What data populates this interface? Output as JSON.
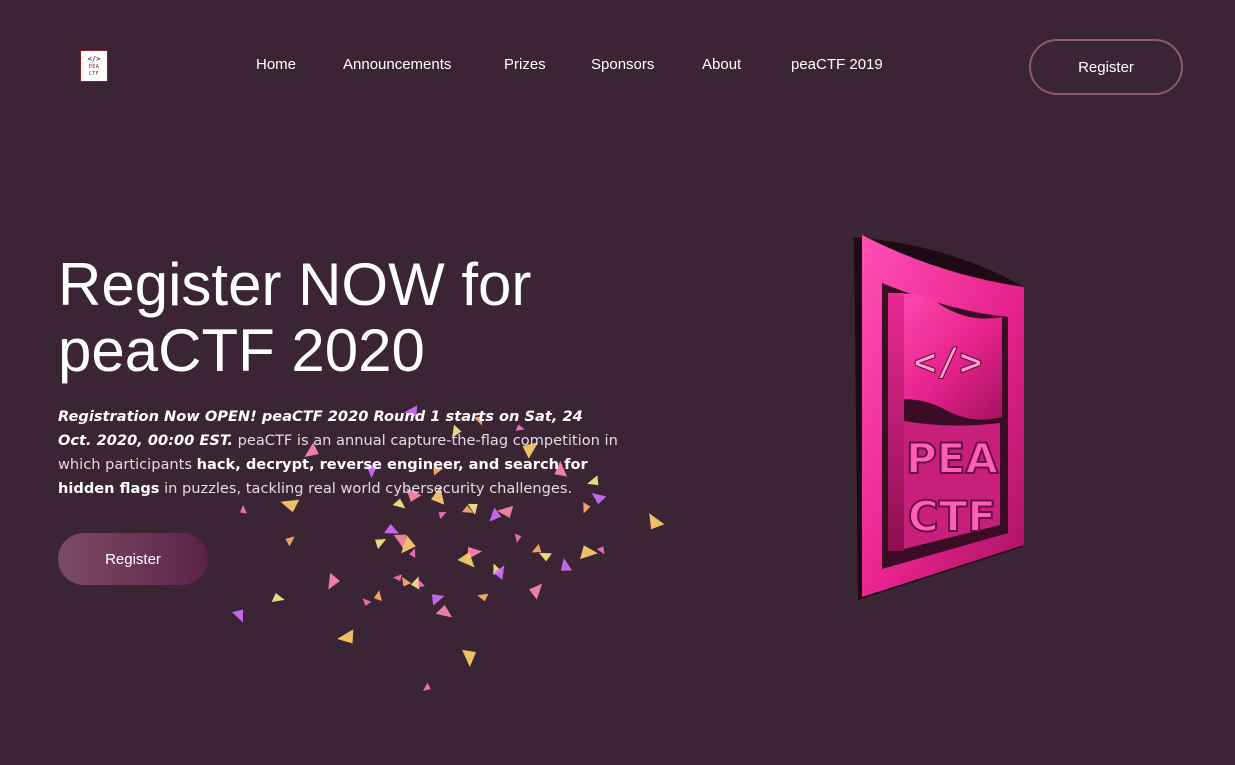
{
  "logo": {
    "code": "</>",
    "line1": "PEA",
    "line2": "CTF"
  },
  "nav": {
    "items": [
      "Home",
      "Announcements",
      "Prizes",
      "Sponsors",
      "About",
      "peaCTF 2019"
    ],
    "register_label": "Register"
  },
  "hero": {
    "title_line1": "Register NOW for",
    "title_line2": "peaCTF 2020",
    "desc_lead": "Registration Now OPEN! peaCTF 2020 Round 1 starts on Sat, 24 Oct. 2020, 00:00 EST.",
    "desc_part1": " peaCTF is an annual capture-the-flag competition in which participants ",
    "desc_bold": "hack, decrypt, reverse engineer, and search for hidden flags",
    "desc_part2": " in puzzles, tackling real world cybersecurity challenges.",
    "register_label": "Register"
  },
  "flag_art": {
    "code": "</>",
    "line1": "PEA",
    "line2": "CTF"
  },
  "colors": {
    "background": "#3b2433",
    "accent": "#ff3fa6",
    "button": "#6a3556"
  }
}
